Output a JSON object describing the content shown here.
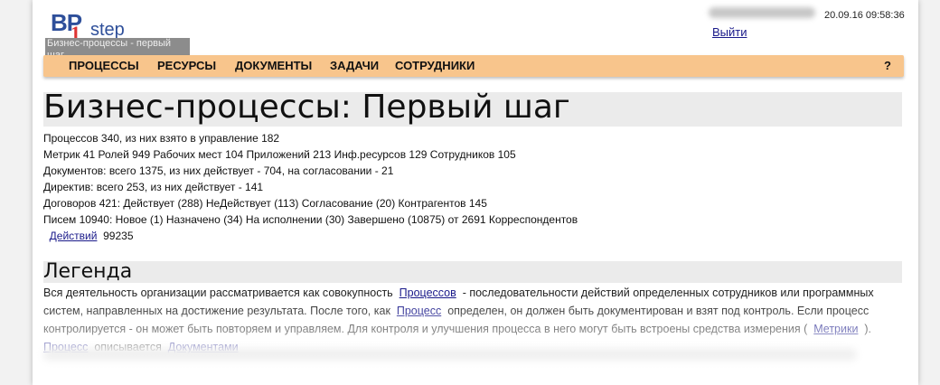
{
  "header": {
    "logo_main": "BP",
    "logo_one": "1",
    "logo_step": "step",
    "logo_tagline": "Бизнес-процессы - первый шаг",
    "datetime": "20.09.16 09:58:36",
    "logout_label": "Выйти"
  },
  "menu": {
    "items": [
      "ПРОЦЕССЫ",
      "РЕСУРСЫ",
      "ДОКУМЕНТЫ",
      "ЗАДАЧИ",
      "СОТРУДНИКИ"
    ],
    "help_label": "?"
  },
  "main": {
    "title": "Бизнес-процессы: Первый шаг",
    "stats": [
      "Процессов 340, из них взято в управление 182",
      "Метрик 41 Ролей 949 Рабочих мест 104 Приложений 213 Инф.ресурсов 129 Сотрудников 105",
      "Документов: всего 1375, из них действует - 704, на согласовании - 21",
      "Директив: всего 253, из них действует - 141",
      "Договоров 421: Действует (288) НеДействует (113) Согласование (20) Контрагентов 145",
      "Писем 10940: Новое (1) Назначено (34) На исполнении (30) Завершено (10875) от 2691 Корреспондентов"
    ],
    "actions_link": "Действий",
    "actions_count": "99235"
  },
  "legend": {
    "title": "Легенда",
    "p1": "Вся деятельность организации рассматривается как совокупность",
    "link_processes": "Процессов",
    "p2": "- последовательности действий определенных сотрудников или программных систем, направленных на достижение результата. После того, как",
    "link_process": "Процесс",
    "p3": "определен, он должен быть документирован и взят под контроль. Если процесс контролируется - он может быть повторяем и управляем. Для контроля и улучшения процесса в него могут быть встроены средства измерения (",
    "link_metrics": "Метрики",
    "p4": ").",
    "link_process2": "Процесс",
    "p5": "описывается",
    "link_documents": "Документами"
  }
}
